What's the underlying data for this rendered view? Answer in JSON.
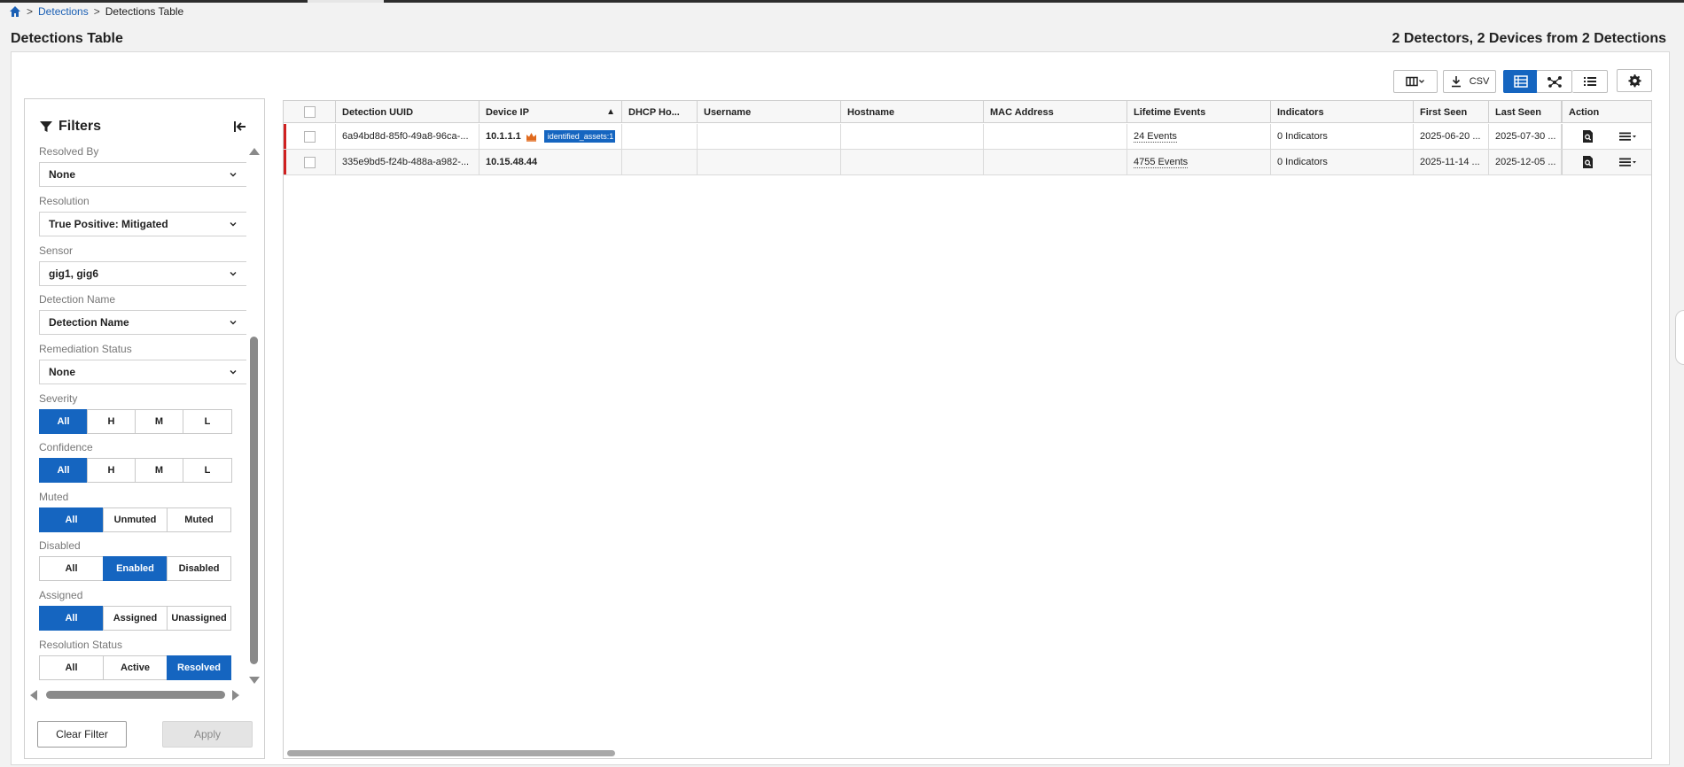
{
  "breadcrumb": {
    "home_icon": "home-icon",
    "separator": ">",
    "items": [
      "Detections",
      "Detections Table"
    ]
  },
  "page": {
    "title": "Detections Table",
    "summary": "2 Detectors, 2 Devices from 2 Detections"
  },
  "colors": {
    "accent": "#1565c0",
    "row_marker": "#d02020",
    "crown": "#e06a1e"
  },
  "filters": {
    "title": "Filters",
    "collapse_icon": "collapse-left-icon",
    "dropdowns": [
      {
        "label": "Resolved By",
        "value": "None"
      },
      {
        "label": "Resolution",
        "value": "True Positive: Mitigated"
      },
      {
        "label": "Sensor",
        "value": "gig1, gig6"
      },
      {
        "label": "Detection Name",
        "value": "Detection Name"
      },
      {
        "label": "Remediation Status",
        "value": "None"
      }
    ],
    "severity": {
      "label": "Severity",
      "options": [
        "All",
        "H",
        "M",
        "L"
      ],
      "selected": "All"
    },
    "confidence": {
      "label": "Confidence",
      "options": [
        "All",
        "H",
        "M",
        "L"
      ],
      "selected": "All"
    },
    "muted": {
      "label": "Muted",
      "options": [
        "All",
        "Unmuted",
        "Muted"
      ],
      "selected": "All"
    },
    "disabled": {
      "label": "Disabled",
      "options": [
        "All",
        "Enabled",
        "Disabled"
      ],
      "selected": "Enabled"
    },
    "assigned": {
      "label": "Assigned",
      "options": [
        "All",
        "Assigned",
        "Unassigned"
      ],
      "selected": "All"
    },
    "resolution_status": {
      "label": "Resolution Status",
      "options": [
        "All",
        "Active",
        "Resolved"
      ],
      "selected": "Resolved"
    },
    "clear_label": "Clear Filter",
    "apply_label": "Apply"
  },
  "toolbar": {
    "columns_icon": "columns-icon",
    "csv_label": "CSV",
    "download_icon": "download-icon",
    "table_view_icon": "table-view-icon",
    "graph_view_icon": "graph-view-icon",
    "list_view_icon": "list-view-icon",
    "settings_icon": "gear-icon"
  },
  "table": {
    "columns": [
      "Detection UUID",
      "Device IP",
      "DHCP Ho...",
      "Username",
      "Hostname",
      "MAC Address",
      "Lifetime Events",
      "Indicators",
      "First Seen",
      "Last Seen",
      "Action"
    ],
    "sort_indicator": "▲",
    "rows": [
      {
        "uuid": "6a94bd8d-85f0-49a8-96ca-...",
        "device_ip": "10.1.1.1",
        "tag": "identified_assets:1",
        "dhcp": "",
        "username": "",
        "hostname": "",
        "mac": "",
        "events": "24 Events",
        "indicators": "0 Indicators",
        "first_seen": "2025-06-20 ...",
        "last_seen": "2025-07-30 ..."
      },
      {
        "uuid": "335e9bd5-f24b-488a-a982-...",
        "device_ip": "10.15.48.44",
        "tag": "",
        "dhcp": "",
        "username": "",
        "hostname": "",
        "mac": "",
        "events": "4755 Events",
        "indicators": "0 Indicators",
        "first_seen": "2025-11-14 ...",
        "last_seen": "2025-12-05 ..."
      }
    ]
  }
}
